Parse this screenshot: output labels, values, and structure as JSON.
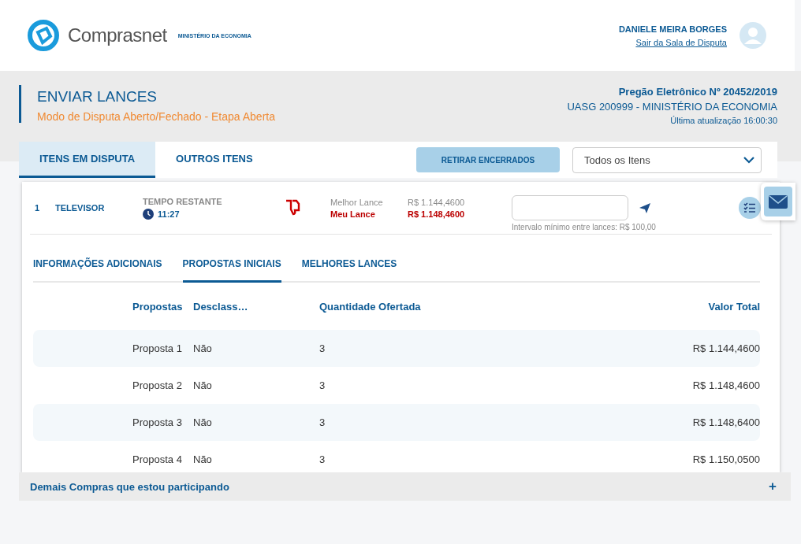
{
  "header": {
    "logo_text": "Comprasnet",
    "ministry": "MINISTÉRIO DA ECONOMIA",
    "user_name": "DANIELE MEIRA BORGES",
    "logout_link": "Sair da Sala de Disputa"
  },
  "page_title": {
    "title": "ENVIAR LANCES",
    "subtitle": "Modo de Disputa Aberto/Fechado - Etapa Aberta",
    "pregao": "Pregão Eletrônico Nº 20452/2019",
    "uasg": "UASG 200999 - MINISTÉRIO DA ECONOMIA",
    "updated": "Última atualização 16:00:30"
  },
  "tabs": [
    {
      "label": "ITENS EM DISPUTA",
      "selected": true
    },
    {
      "label": "OUTROS ITENS",
      "selected": false
    }
  ],
  "retirar_button": "RETIRAR ENCERRADOS",
  "filter_select": {
    "value": "Todos os Itens"
  },
  "item": {
    "number": "1",
    "name": "TELEVISOR",
    "time_label": "TEMPO RESTANTE",
    "time": "11:27",
    "best_label": "Melhor Lance",
    "best_value": "R$ 1.144,4600",
    "my_label": "Meu Lance",
    "my_value": "R$ 1.148,4600",
    "bid_hint": "Intervalo mínimo entre lances: R$ 100,00"
  },
  "sub_tabs": [
    {
      "label": "INFORMAÇÕES ADICIONAIS",
      "selected": false
    },
    {
      "label": "PROPOSTAS INICIAIS",
      "selected": true
    },
    {
      "label": "MELHORES LANCES",
      "selected": false
    }
  ],
  "table": {
    "columns": [
      "Propostas",
      "Desclass…",
      "Quantidade Ofertada",
      "Valor Total"
    ],
    "rows": [
      [
        "Proposta 1",
        "Não",
        "3",
        "R$ 1.144,4600"
      ],
      [
        "Proposta 2",
        "Não",
        "3",
        "R$ 1.148,4600"
      ],
      [
        "Proposta 3",
        "Não",
        "3",
        "R$ 1.148,6400"
      ],
      [
        "Proposta 4",
        "Não",
        "3",
        "R$ 1.150,0500"
      ]
    ]
  },
  "footer_bar": {
    "label": "Demais Compras que estou participando",
    "toggle": "+"
  }
}
